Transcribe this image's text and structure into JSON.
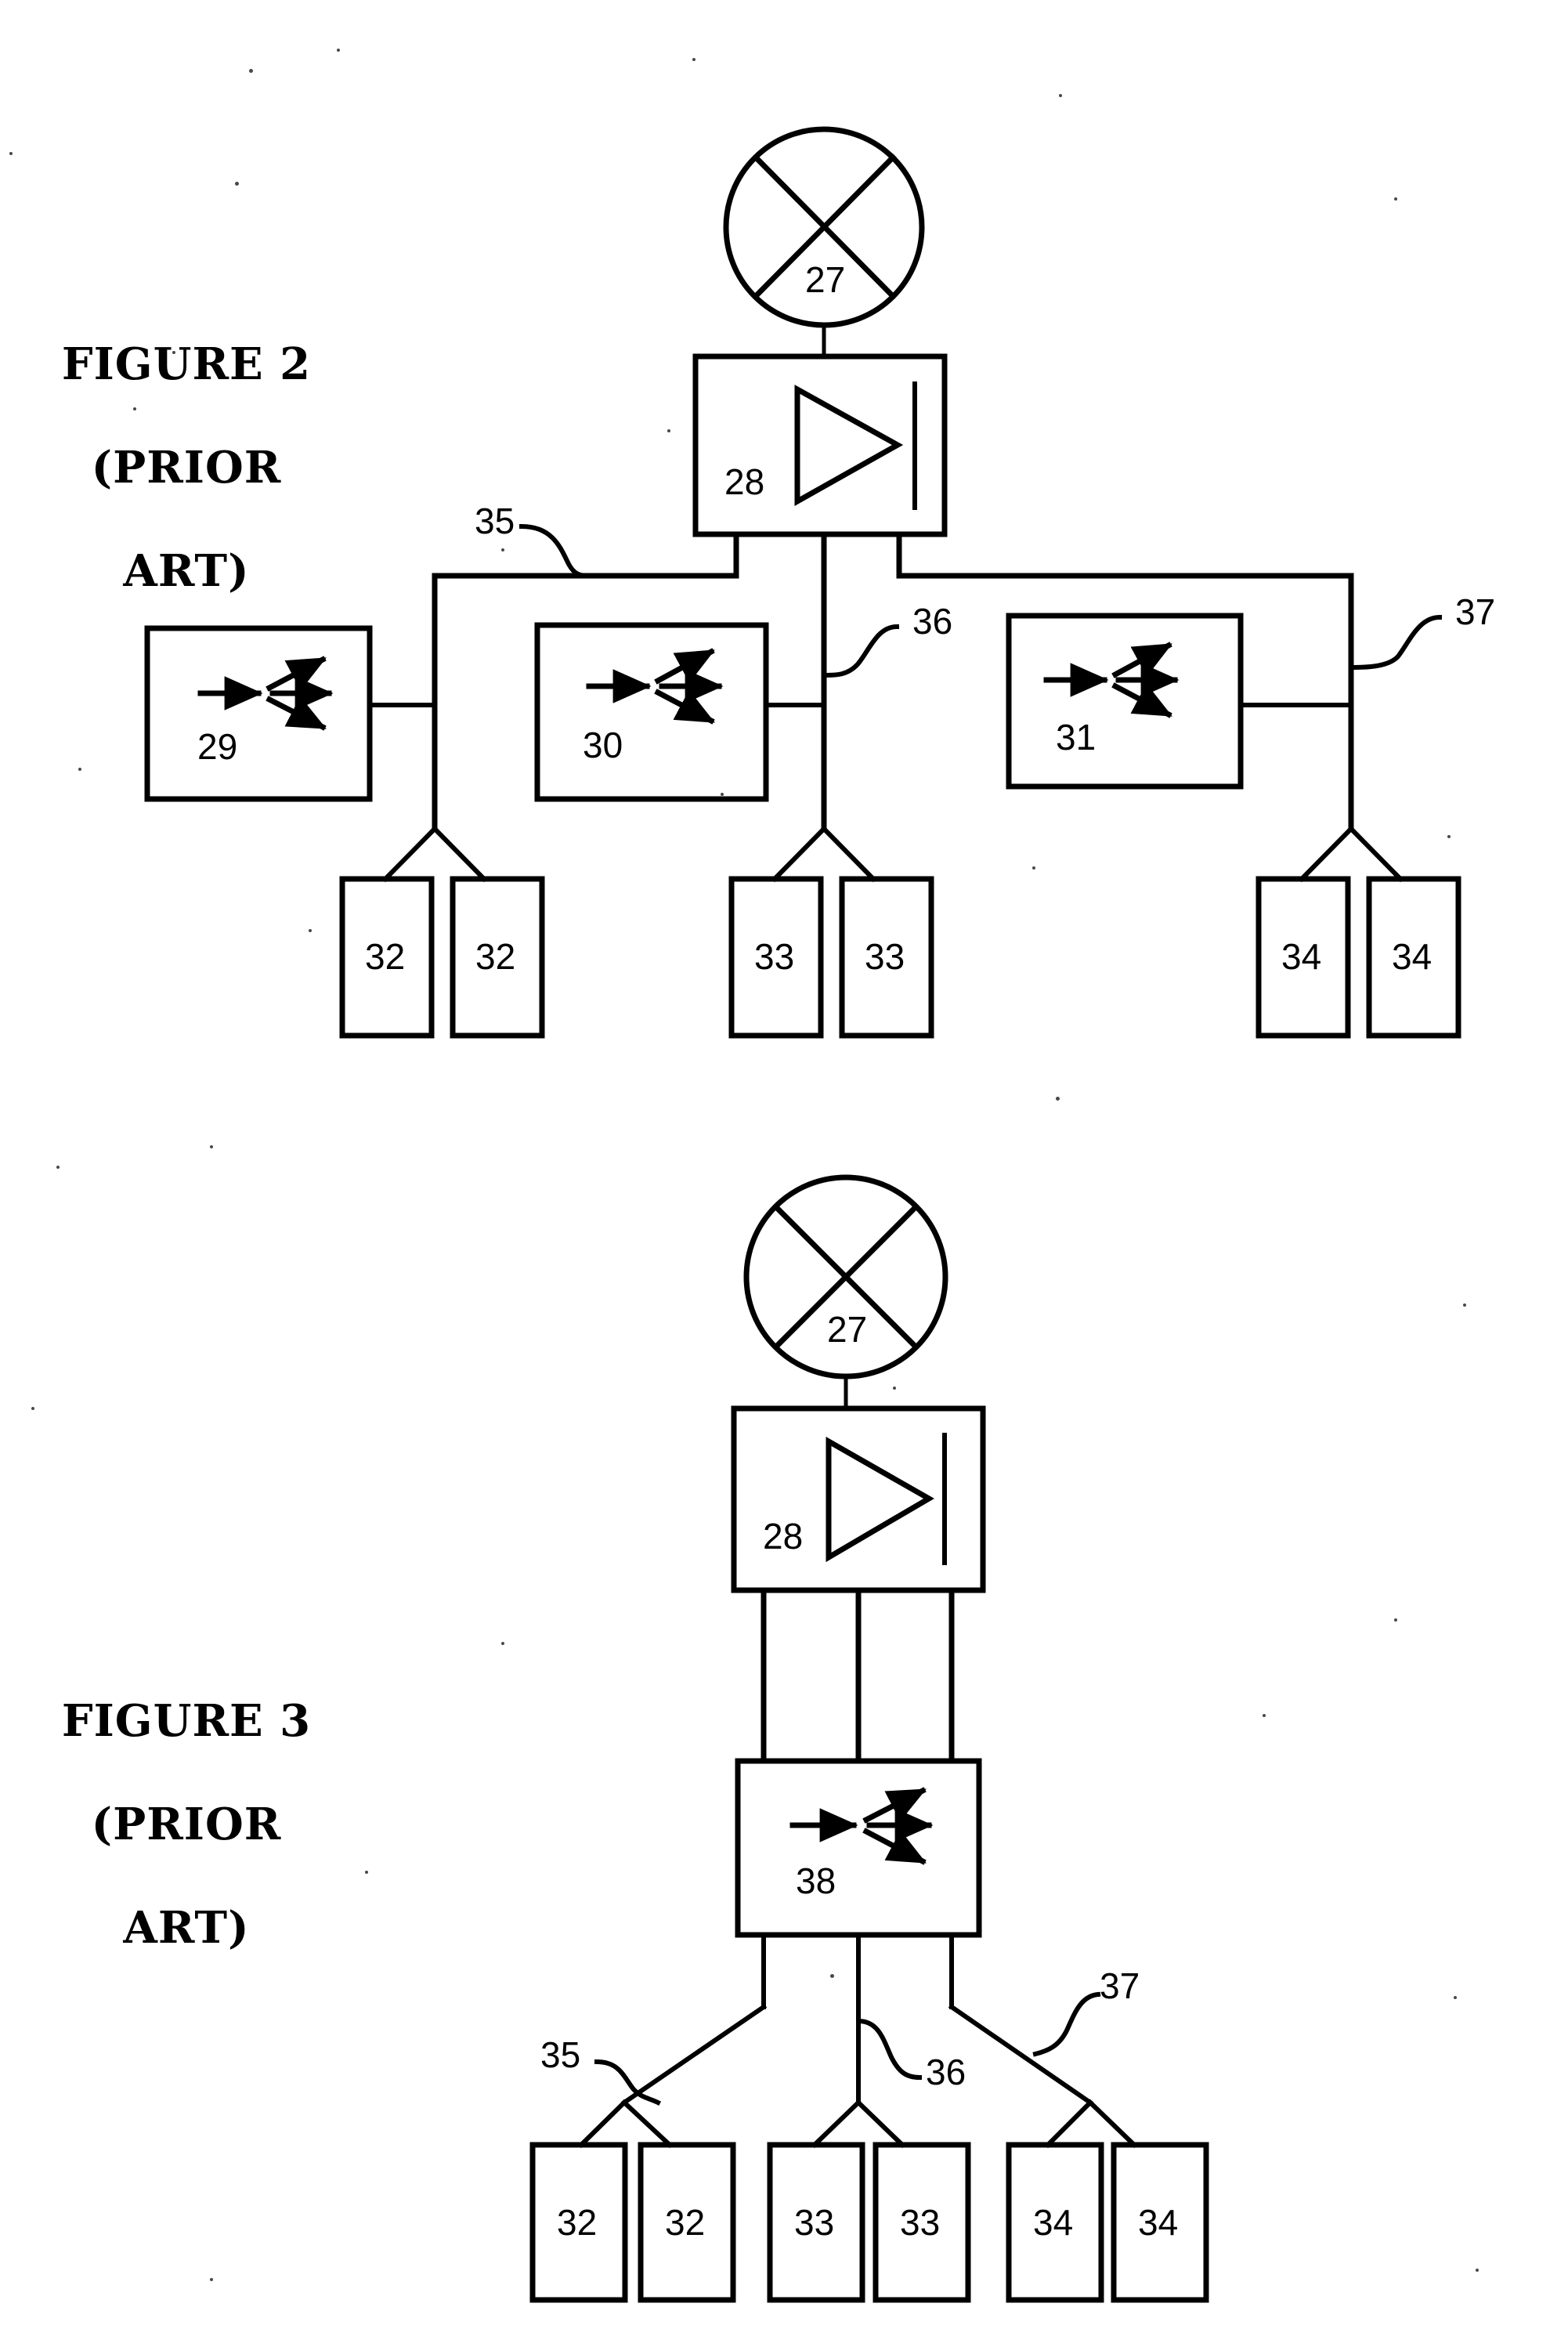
{
  "document": {
    "type": "patent-drawing-sheet",
    "background_color": "#ffffff",
    "ink_color": "#000000"
  },
  "figures": [
    {
      "id": "figure-2",
      "title": "FIGURE 2\n(PRIOR\nART)",
      "title_line1": "FIGURE 2",
      "title_line2": "(PRIOR",
      "title_line3": "ART)",
      "nodes": {
        "antenna": {
          "ref": "27",
          "symbol": "crossed-circle-antenna"
        },
        "amplifier": {
          "ref": "28",
          "symbol": "triangle-amplifier"
        },
        "splitter_left": {
          "ref": "29",
          "symbol": "three-way-splitter"
        },
        "splitter_center": {
          "ref": "30",
          "symbol": "three-way-splitter"
        },
        "splitter_right": {
          "ref": "31",
          "symbol": "three-way-splitter"
        },
        "outlets_left": [
          "32",
          "32"
        ],
        "outlets_center": [
          "33",
          "33"
        ],
        "outlets_right": [
          "34",
          "34"
        ]
      },
      "cable_refs": {
        "left": "35",
        "center": "36",
        "right": "37"
      }
    },
    {
      "id": "figure-3",
      "title": "FIGURE 3\n(PRIOR\nART)",
      "title_line1": "FIGURE 3",
      "title_line2": "(PRIOR",
      "title_line3": "ART)",
      "nodes": {
        "antenna": {
          "ref": "27",
          "symbol": "crossed-circle-antenna"
        },
        "amplifier": {
          "ref": "28",
          "symbol": "triangle-amplifier"
        },
        "splitter": {
          "ref": "38",
          "symbol": "three-way-splitter"
        },
        "outlets_left": [
          "32",
          "32"
        ],
        "outlets_center": [
          "33",
          "33"
        ],
        "outlets_right": [
          "34",
          "34"
        ]
      },
      "cable_refs": {
        "left": "35",
        "center": "36",
        "right": "37"
      }
    }
  ],
  "chart_data": {
    "type": "diagram",
    "title": "Prior art CATV distribution block diagrams",
    "diagrams": [
      {
        "name": "FIGURE 2 (PRIOR ART)",
        "topology": "antenna -> amplifier -> three separate splitters on a shared bus -> outlet pairs",
        "blocks": [
          {
            "ref": "27",
            "label": "27",
            "kind": "antenna"
          },
          {
            "ref": "28",
            "label": "28",
            "kind": "amplifier"
          },
          {
            "ref": "29",
            "label": "29",
            "kind": "splitter"
          },
          {
            "ref": "30",
            "label": "30",
            "kind": "splitter"
          },
          {
            "ref": "31",
            "label": "31",
            "kind": "splitter"
          },
          {
            "ref": "32",
            "label": "32",
            "kind": "outlet"
          },
          {
            "ref": "32",
            "label": "32",
            "kind": "outlet"
          },
          {
            "ref": "33",
            "label": "33",
            "kind": "outlet"
          },
          {
            "ref": "33",
            "label": "33",
            "kind": "outlet"
          },
          {
            "ref": "34",
            "label": "34",
            "kind": "outlet"
          },
          {
            "ref": "34",
            "label": "34",
            "kind": "outlet"
          }
        ],
        "cables": [
          {
            "ref": "35",
            "label": "35"
          },
          {
            "ref": "36",
            "label": "36"
          },
          {
            "ref": "37",
            "label": "37"
          }
        ]
      },
      {
        "name": "FIGURE 3 (PRIOR ART)",
        "topology": "antenna -> amplifier -> single multi-output splitter 38 -> three cable runs -> outlet pairs",
        "blocks": [
          {
            "ref": "27",
            "label": "27",
            "kind": "antenna"
          },
          {
            "ref": "28",
            "label": "28",
            "kind": "amplifier"
          },
          {
            "ref": "38",
            "label": "38",
            "kind": "splitter"
          },
          {
            "ref": "32",
            "label": "32",
            "kind": "outlet"
          },
          {
            "ref": "32",
            "label": "32",
            "kind": "outlet"
          },
          {
            "ref": "33",
            "label": "33",
            "kind": "outlet"
          },
          {
            "ref": "33",
            "label": "33",
            "kind": "outlet"
          },
          {
            "ref": "34",
            "label": "34",
            "kind": "outlet"
          },
          {
            "ref": "34",
            "label": "34",
            "kind": "outlet"
          }
        ],
        "cables": [
          {
            "ref": "35",
            "label": "35"
          },
          {
            "ref": "36",
            "label": "36"
          },
          {
            "ref": "37",
            "label": "37"
          }
        ]
      }
    ]
  }
}
